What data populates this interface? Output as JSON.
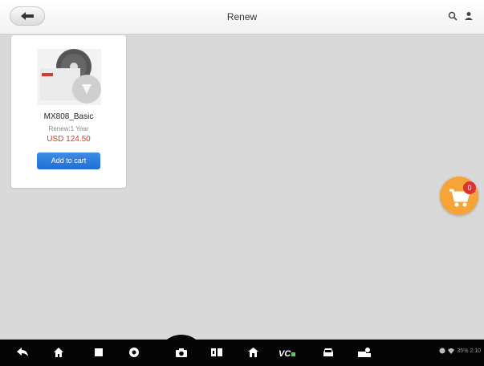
{
  "header": {
    "title": "Renew",
    "back_icon": "back-arrow-icon",
    "search_icon": "search-icon",
    "account_icon": "user-icon"
  },
  "product": {
    "name": "MX808_Basic",
    "term": "Renew:1 Year",
    "price": "USD 124.50",
    "add_to_cart_label": "Add to cart"
  },
  "cart": {
    "count": "0",
    "icon": "shopping-cart-icon"
  },
  "navbar": {
    "buttons": [
      "back-icon",
      "home-icon",
      "recent-apps-icon",
      "browser-icon",
      "camera-icon",
      "display-icon",
      "home-house-icon",
      "vci-icon",
      "car-icon",
      "shop-icon"
    ],
    "status_text": "35% 2:10"
  },
  "colors": {
    "background": "#d9d9d9",
    "price_red": "#d63a35",
    "button_blue": "#2a7ce0",
    "cart_orange": "#f6a43a",
    "badge_red": "#e03030",
    "navbar": "#050505"
  }
}
